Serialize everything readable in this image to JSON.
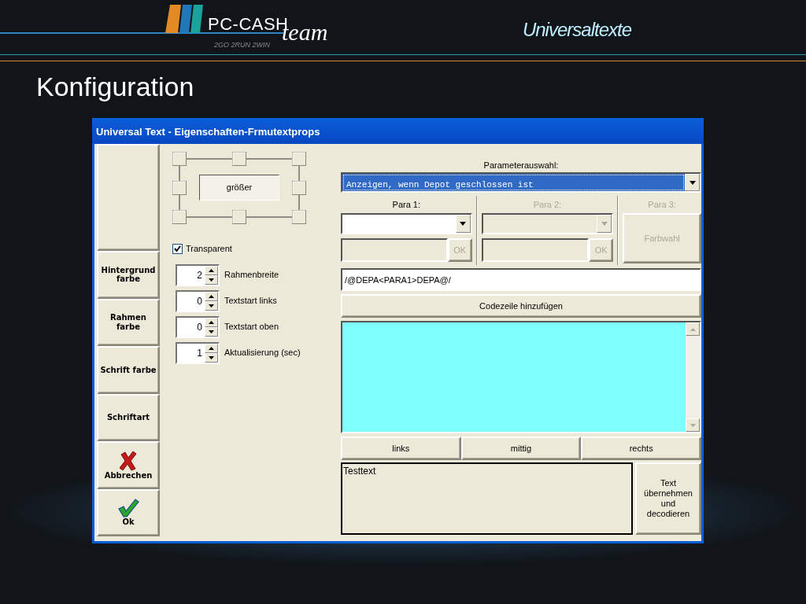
{
  "slide": {
    "header_title": "Universaltexte",
    "logo": {
      "name": "PC-CASH",
      "word": "team",
      "tagline": "2GO 2RUN 2WIN"
    },
    "title": "Konfiguration"
  },
  "dialog": {
    "title": "Universal Text - Eigenschaften-Frmutextprops",
    "side_buttons": [
      {
        "kind": "blank"
      },
      {
        "kind": "text",
        "label": "Hintergrund\nfarbe"
      },
      {
        "kind": "text",
        "label": "Rahmen\nfarbe"
      },
      {
        "kind": "text",
        "label": "Schrift farbe"
      },
      {
        "kind": "text",
        "label": "Schriftart"
      },
      {
        "kind": "cancel",
        "label": "Abbrechen"
      },
      {
        "kind": "ok",
        "label": "Ok"
      }
    ],
    "size_button": "größer",
    "transparent": {
      "label": "Transparent",
      "checked": true
    },
    "spinners": [
      {
        "value": "2",
        "label": "Rahmenbreite"
      },
      {
        "value": "0",
        "label": "Textstart links"
      },
      {
        "value": "0",
        "label": "Textstart oben"
      },
      {
        "value": "1",
        "label": "Aktualisierung (sec)"
      }
    ],
    "parameter": {
      "label": "Parameterauswahl:",
      "value": "Anzeigen, wenn Depot geschlossen ist"
    },
    "params": [
      {
        "kind": "combo",
        "label": "Para 1:",
        "disabled": false,
        "ok": {
          "label": "OK",
          "disabled": true
        }
      },
      {
        "kind": "combo",
        "label": "Para 2:",
        "disabled": true,
        "ok": {
          "label": "OK",
          "disabled": true
        }
      },
      {
        "kind": "button",
        "label": "Para 3:",
        "disabled": true,
        "button": "Farbwahl"
      }
    ],
    "code_line": "/@DEPA<PARA1>DEPA@/",
    "add_button": "Codezeile hinzufügen",
    "align_buttons": [
      "links",
      "mittig",
      "rechts"
    ],
    "test_text": "Testtext",
    "apply_button": "Text\nübernehmen\nund\ndecodieren"
  }
}
